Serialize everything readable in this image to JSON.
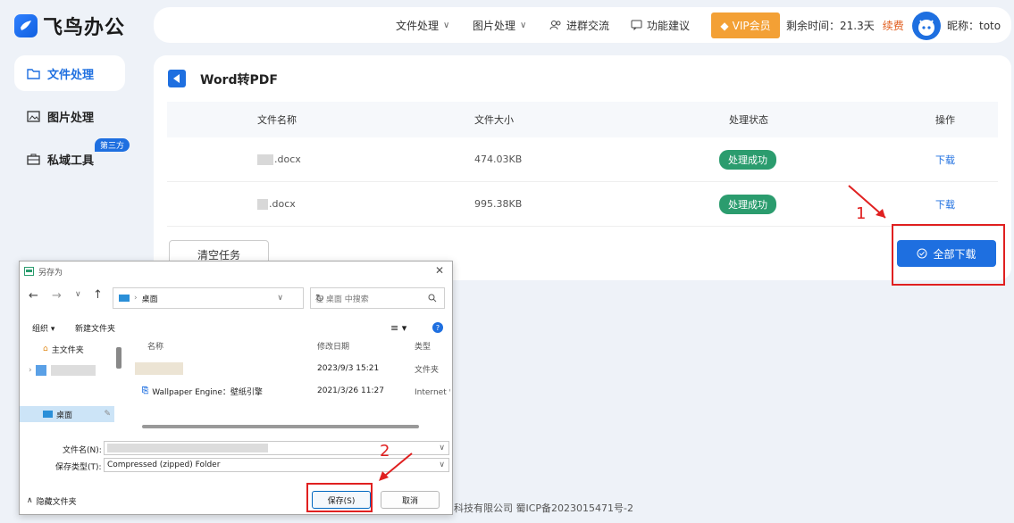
{
  "brand": {
    "name": "飞鸟办公"
  },
  "topbar": {
    "nav": [
      "文件处理",
      "图片处理"
    ],
    "join_group": "进群交流",
    "suggest": "功能建议",
    "vip": "VIP会员",
    "remaining": "剩余时间：21.3天",
    "renew": "续费",
    "nickname": "昵称：toto"
  },
  "sidebar": {
    "items": [
      {
        "label": "文件处理",
        "icon": "folder-icon",
        "active": true
      },
      {
        "label": "图片处理",
        "icon": "image-icon",
        "active": false
      },
      {
        "label": "私域工具",
        "icon": "toolbox-icon",
        "active": false
      }
    ],
    "badge": "第三方"
  },
  "panel": {
    "title": "Word转PDF",
    "columns": [
      "文件名称",
      "文件大小",
      "处理状态",
      "操作"
    ],
    "rows": [
      {
        "name": ".docx",
        "size": "474.03KB",
        "status": "处理成功",
        "action": "下载"
      },
      {
        "name": ".docx",
        "size": "995.38KB",
        "status": "处理成功",
        "action": "下载"
      }
    ],
    "clear_button": "清空任务",
    "download_all_button": "全部下载"
  },
  "annotations": {
    "step1": "1",
    "step2": "2"
  },
  "footer": {
    "text": "科技有限公司  蜀ICP备2023015471号-2"
  },
  "dialog": {
    "title": "另存为",
    "location": "桌面",
    "search_placeholder": "在 桌面 中搜索",
    "organize": "组织 ▾",
    "new_folder": "新建文件夹",
    "tree": [
      "主文件夹",
      "桌面"
    ],
    "columns": [
      "名称",
      "修改日期",
      "类型"
    ],
    "files": [
      {
        "name": "",
        "date": "2023/9/3 15:21",
        "type": "文件夹"
      },
      {
        "name": "Wallpaper Engine：壁纸引擎",
        "date": "2021/3/26 11:27",
        "type": "Internet 快"
      }
    ],
    "filename_label": "文件名(N):",
    "filetype_label": "保存类型(T):",
    "filetype_value": "Compressed (zipped) Folder",
    "hide_folders": "隐藏文件夹",
    "save": "保存(S)",
    "cancel": "取消"
  },
  "colors": {
    "accent": "#1e6fe0",
    "success": "#2b9c6e",
    "vip": "#f3a035",
    "annotation": "#e02020"
  }
}
